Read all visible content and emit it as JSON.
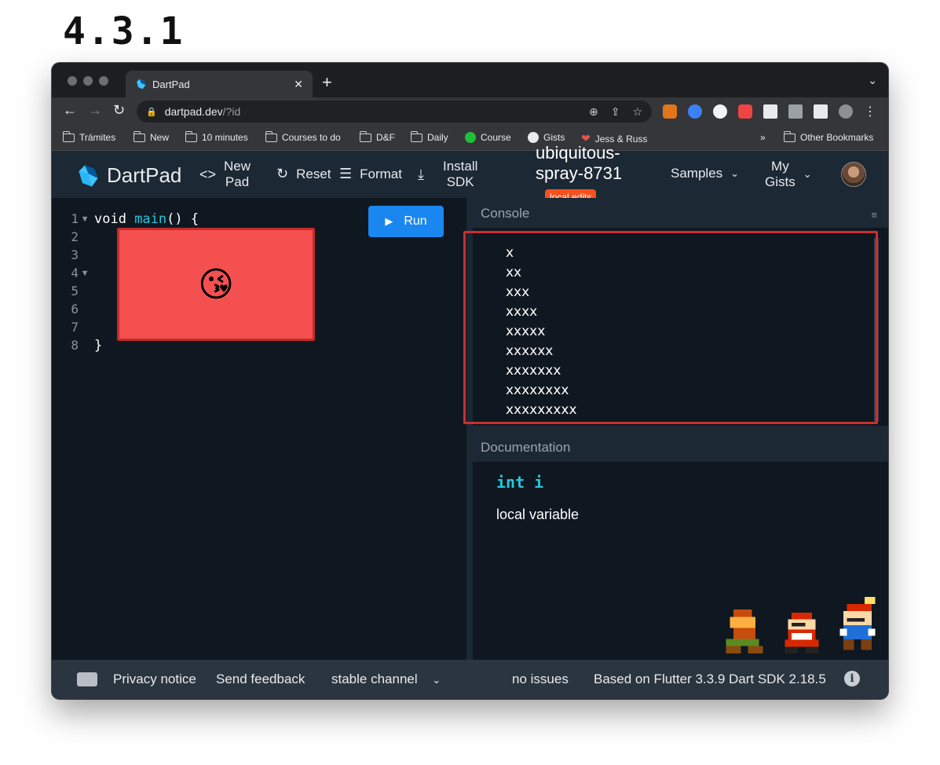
{
  "page_title": "4.3.1",
  "browser": {
    "tab_title": "DartPad",
    "tab_close": "✕",
    "new_tab": "+",
    "url_host": "dartpad.dev",
    "url_path": "/?id",
    "bookmarks": [
      {
        "label": "Trámites",
        "icon": "folder-icon"
      },
      {
        "label": "New",
        "icon": "folder-icon"
      },
      {
        "label": "10 minutes",
        "icon": "folder-icon"
      },
      {
        "label": "Courses to do",
        "icon": "folder-icon"
      },
      {
        "label": "D&F",
        "icon": "folder-icon"
      },
      {
        "label": "Daily",
        "icon": "folder-icon"
      },
      {
        "label": "Course",
        "icon": "course-icon"
      },
      {
        "label": "Gists",
        "icon": "github-icon"
      },
      {
        "label": "Jess & Russ",
        "icon": "heart-icon"
      }
    ],
    "bookmarks_overflow": "»",
    "other_bookmarks": "Other Bookmarks"
  },
  "header": {
    "logo_text": "DartPad",
    "new_pad": [
      "New",
      "Pad"
    ],
    "reset": "Reset",
    "format": "Format",
    "install_sdk": [
      "Install",
      "SDK"
    ],
    "pad_name": [
      "ubiquitous-",
      "spray-8731"
    ],
    "badge": "local edits",
    "samples": "Samples",
    "my_gists": [
      "My",
      "Gists"
    ]
  },
  "editor": {
    "run_label": "Run",
    "lines": [
      {
        "num": "1",
        "fold": "▼",
        "code_a": "void ",
        "code_fn": "main",
        "code_b": "() {"
      },
      {
        "num": "2",
        "fold": "",
        "code_a": "",
        "code_fn": "",
        "code_b": ""
      },
      {
        "num": "3",
        "fold": "",
        "code_a": "",
        "code_fn": "",
        "code_b": ""
      },
      {
        "num": "4",
        "fold": "▼",
        "code_a": "",
        "code_fn": "",
        "code_b": ""
      },
      {
        "num": "5",
        "fold": "",
        "code_a": "",
        "code_fn": "",
        "code_b": ""
      },
      {
        "num": "6",
        "fold": "",
        "code_a": "",
        "code_fn": "",
        "code_b": ""
      },
      {
        "num": "7",
        "fold": "",
        "code_a": "",
        "code_fn": "",
        "code_b": ""
      },
      {
        "num": "8",
        "fold": "",
        "code_a": "}",
        "code_fn": "",
        "code_b": ""
      }
    ],
    "overlay_emoji": "😘"
  },
  "console": {
    "title": "Console",
    "output": [
      "x",
      "xx",
      "xxx",
      "xxxx",
      "xxxxx",
      "xxxxxx",
      "xxxxxxx",
      "xxxxxxxx",
      "xxxxxxxxx"
    ]
  },
  "docs": {
    "title": "Documentation",
    "signature": "int i",
    "kind": "local variable"
  },
  "footer": {
    "privacy": "Privacy notice",
    "feedback": "Send feedback",
    "channel": "stable channel",
    "issues": "no issues",
    "version": "Based on Flutter 3.3.9 Dart SDK 2.18.5"
  },
  "colors": {
    "accent": "#1a87f0",
    "badge": "#f4511e",
    "highlight_frame": "#cc2f2f",
    "overlay_fill": "#f45050",
    "function_name": "#26c6da"
  }
}
